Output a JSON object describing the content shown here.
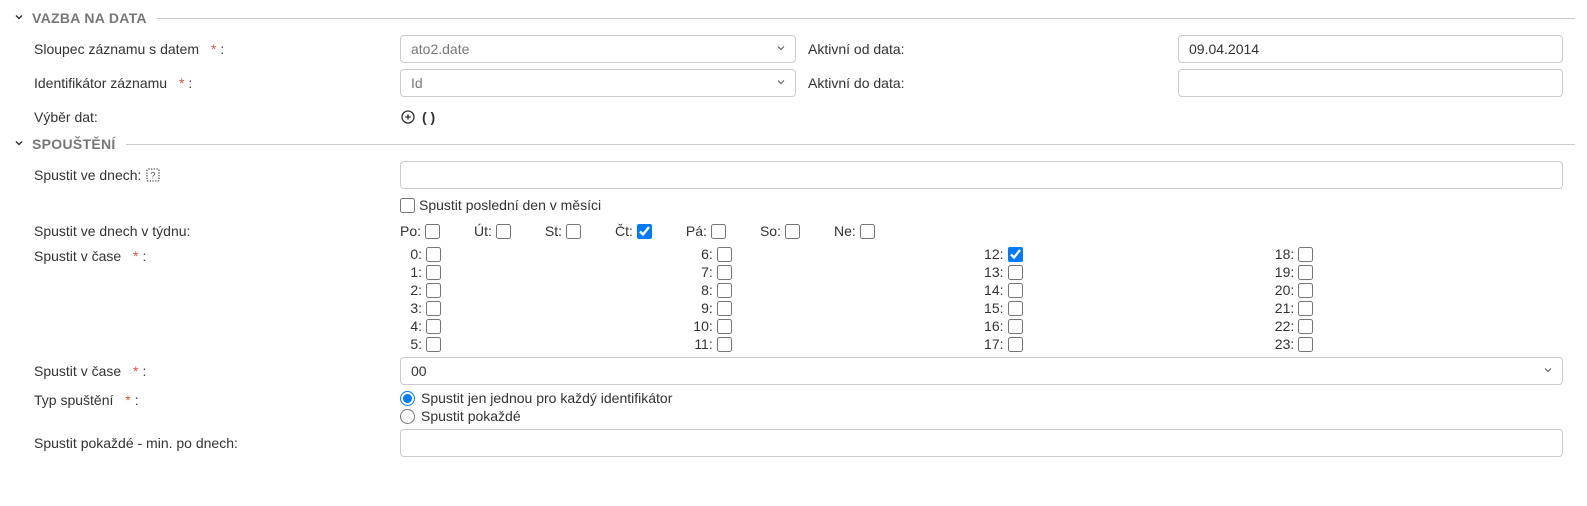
{
  "section1": {
    "title": "VAZBA NA DATA",
    "row1": {
      "label": "Sloupec záznamu s datem",
      "value": "ato2.date"
    },
    "row1b": {
      "label": "Aktivní od data:",
      "value": "09.04.2014"
    },
    "row2": {
      "label": "Identifikátor záznamu",
      "value": "Id"
    },
    "row2b": {
      "label": "Aktivní do data:",
      "value": ""
    },
    "row3": {
      "label": "Výběr dat:",
      "parens": "( )"
    }
  },
  "section2": {
    "title": "SPOUŠTĚNÍ",
    "run_days": {
      "label": "Spustit ve dnech:",
      "value": ""
    },
    "last_day": {
      "label": "Spustit poslední den v měsíci",
      "checked": false
    },
    "weekdays": {
      "label": "Spustit ve dnech v týdnu:",
      "days": [
        {
          "label": "Po:",
          "checked": false
        },
        {
          "label": "Út:",
          "checked": false
        },
        {
          "label": "St:",
          "checked": false
        },
        {
          "label": "Čt:",
          "checked": true
        },
        {
          "label": "Pá:",
          "checked": false
        },
        {
          "label": "So:",
          "checked": false
        },
        {
          "label": "Ne:",
          "checked": false
        }
      ]
    },
    "run_hours": {
      "label": "Spustit v čase",
      "cols": [
        [
          {
            "h": "0:",
            "c": false
          },
          {
            "h": "1:",
            "c": false
          },
          {
            "h": "2:",
            "c": false
          },
          {
            "h": "3:",
            "c": false
          },
          {
            "h": "4:",
            "c": false
          },
          {
            "h": "5:",
            "c": false
          }
        ],
        [
          {
            "h": "6:",
            "c": false
          },
          {
            "h": "7:",
            "c": false
          },
          {
            "h": "8:",
            "c": false
          },
          {
            "h": "9:",
            "c": false
          },
          {
            "h": "10:",
            "c": false
          },
          {
            "h": "11:",
            "c": false
          }
        ],
        [
          {
            "h": "12:",
            "c": true
          },
          {
            "h": "13:",
            "c": false
          },
          {
            "h": "14:",
            "c": false
          },
          {
            "h": "15:",
            "c": false
          },
          {
            "h": "16:",
            "c": false
          },
          {
            "h": "17:",
            "c": false
          }
        ],
        [
          {
            "h": "18:",
            "c": false
          },
          {
            "h": "19:",
            "c": false
          },
          {
            "h": "20:",
            "c": false
          },
          {
            "h": "21:",
            "c": false
          },
          {
            "h": "22:",
            "c": false
          },
          {
            "h": "23:",
            "c": false
          }
        ]
      ]
    },
    "run_at": {
      "label": "Spustit v čase",
      "value": "00"
    },
    "run_type": {
      "label": "Typ spuštění",
      "opt1": "Spustit jen jednou pro každý identifikátor",
      "opt2": "Spustit pokaždé",
      "selected": 1
    },
    "min_days": {
      "label": "Spustit pokaždé - min. po dnech:",
      "value": ""
    }
  }
}
